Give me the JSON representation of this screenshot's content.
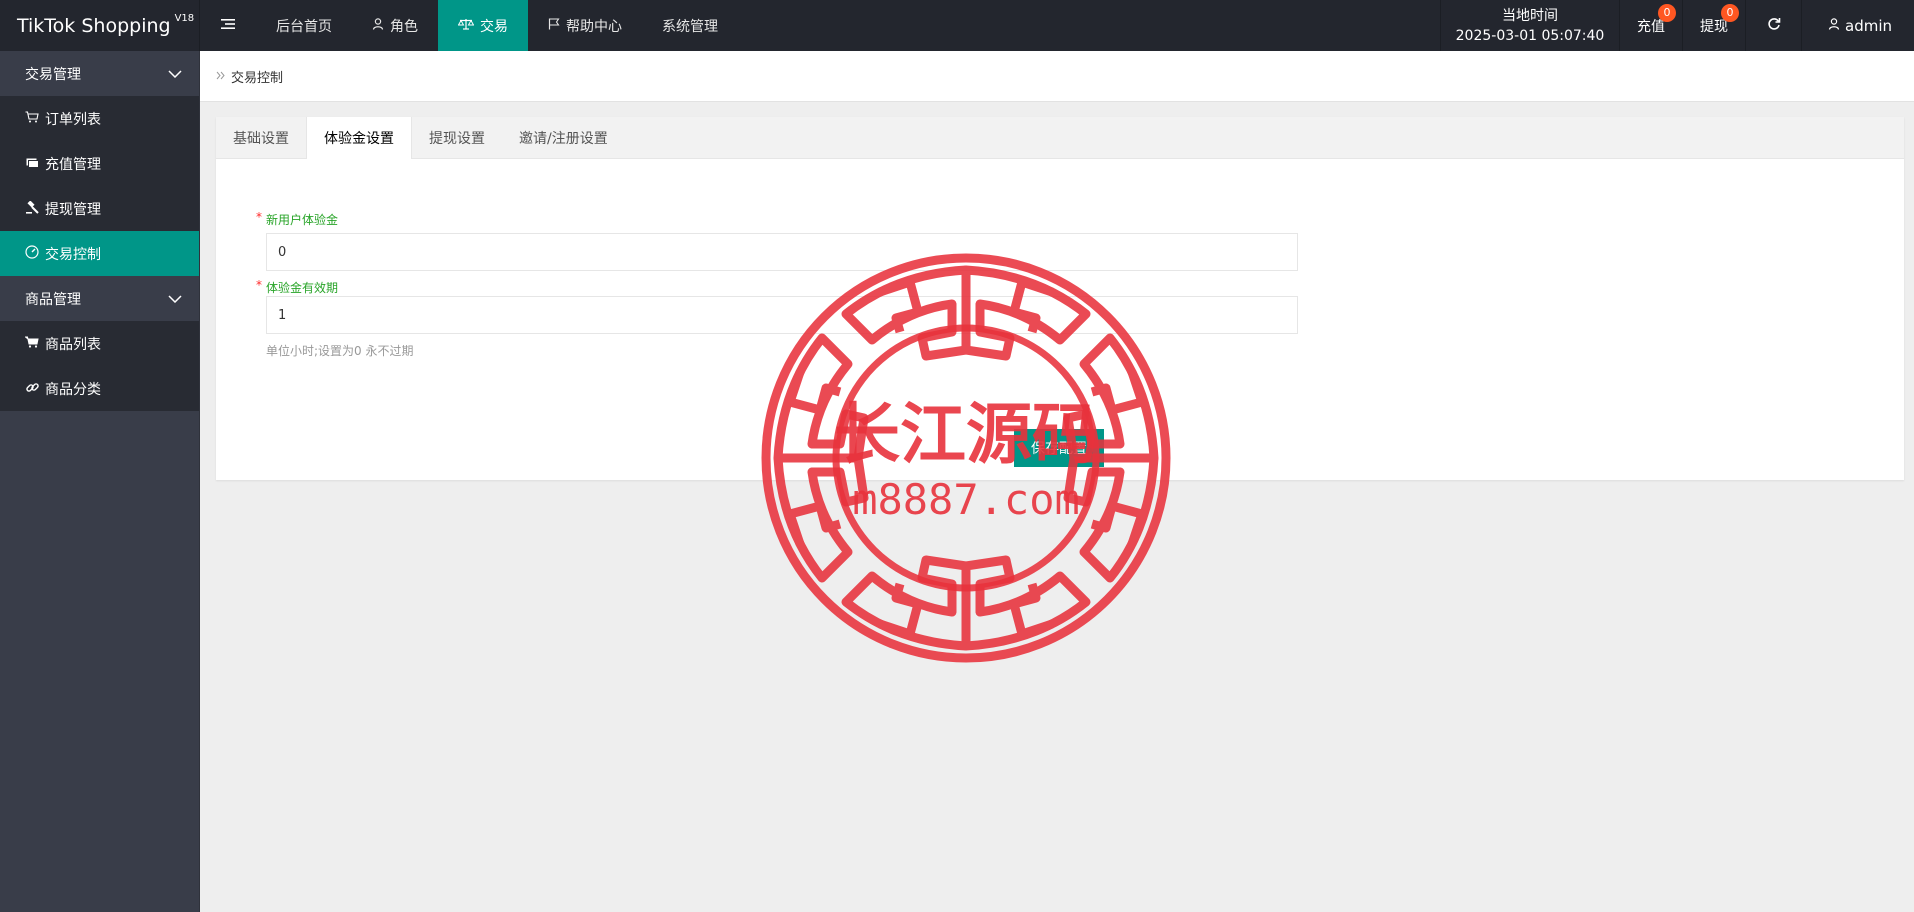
{
  "brand": {
    "name": "TikTok Shopping",
    "version": "V18"
  },
  "topnav": [
    {
      "label": "后台首页",
      "icon": ""
    },
    {
      "label": "角色",
      "icon": "user-icon"
    },
    {
      "label": "交易",
      "icon": "scale-icon",
      "active": true
    },
    {
      "label": "帮助中心",
      "icon": "flag-icon"
    },
    {
      "label": "系统管理",
      "icon": ""
    }
  ],
  "clock": {
    "label": "当地时间",
    "value": "2025-03-01 05:07:40"
  },
  "recharge": {
    "label": "充值",
    "badge": "0"
  },
  "withdraw": {
    "label": "提现",
    "badge": "0"
  },
  "user": {
    "name": "admin"
  },
  "sidebar": {
    "group1": "交易管理",
    "items1": [
      {
        "label": "订单列表",
        "icon": "cart-icon"
      },
      {
        "label": "充值管理",
        "icon": "card-icon"
      },
      {
        "label": "提现管理",
        "icon": "gavel-icon"
      },
      {
        "label": "交易控制",
        "icon": "dashboard-icon",
        "active": true
      }
    ],
    "group2": "商品管理",
    "items2": [
      {
        "label": "商品列表",
        "icon": "shopping-cart-icon"
      },
      {
        "label": "商品分类",
        "icon": "link-icon"
      }
    ]
  },
  "breadcrumb": {
    "current": "交易控制"
  },
  "tabs": [
    "基础设置",
    "体验金设置",
    "提现设置",
    "邀请/注册设置"
  ],
  "form": {
    "field1": {
      "label": "新用户体验金",
      "value": "0"
    },
    "field2": {
      "label": "体验金有效期",
      "value": "1",
      "hint": "单位小时;设置为0 永不过期"
    },
    "save_label": "保存配置"
  },
  "watermark": {
    "line1": "长江源码",
    "line2": "m8887.com"
  },
  "colors": {
    "accent": "#009688",
    "topbar": "#23262e",
    "sidebar": "#393d49",
    "badge": "#ff5722",
    "stamp": "#e8323c"
  }
}
